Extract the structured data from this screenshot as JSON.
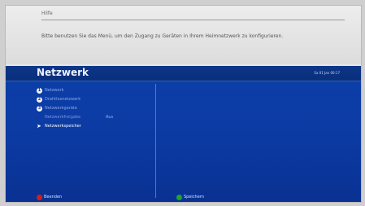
{
  "help": {
    "title": "Hilfe",
    "text": "Bitte benutzen Sie das Menü, um den Zugang zu Geräten in Ihrem Heimnetzwerk zu konfigurieren."
  },
  "panel": {
    "title": "Netzwerk",
    "datetime": "Sa 01 Jan 00:17"
  },
  "menu": {
    "items": [
      {
        "num": "1",
        "label": "Netzwerk"
      },
      {
        "num": "2",
        "label": "Drahtlosnetzwerk"
      },
      {
        "num": "3",
        "label": "Netzwerkgeräte"
      }
    ],
    "dim": {
      "label": "Netzwerkfreigabe",
      "value": "Aus"
    },
    "active": {
      "label": "Netzwerkspeicher"
    }
  },
  "footer": {
    "left": "Beenden",
    "right": "Speichern"
  },
  "colors": {
    "panel": "#0b3aa2",
    "red_key": "#d71c1c",
    "green_key": "#1ca62c"
  }
}
